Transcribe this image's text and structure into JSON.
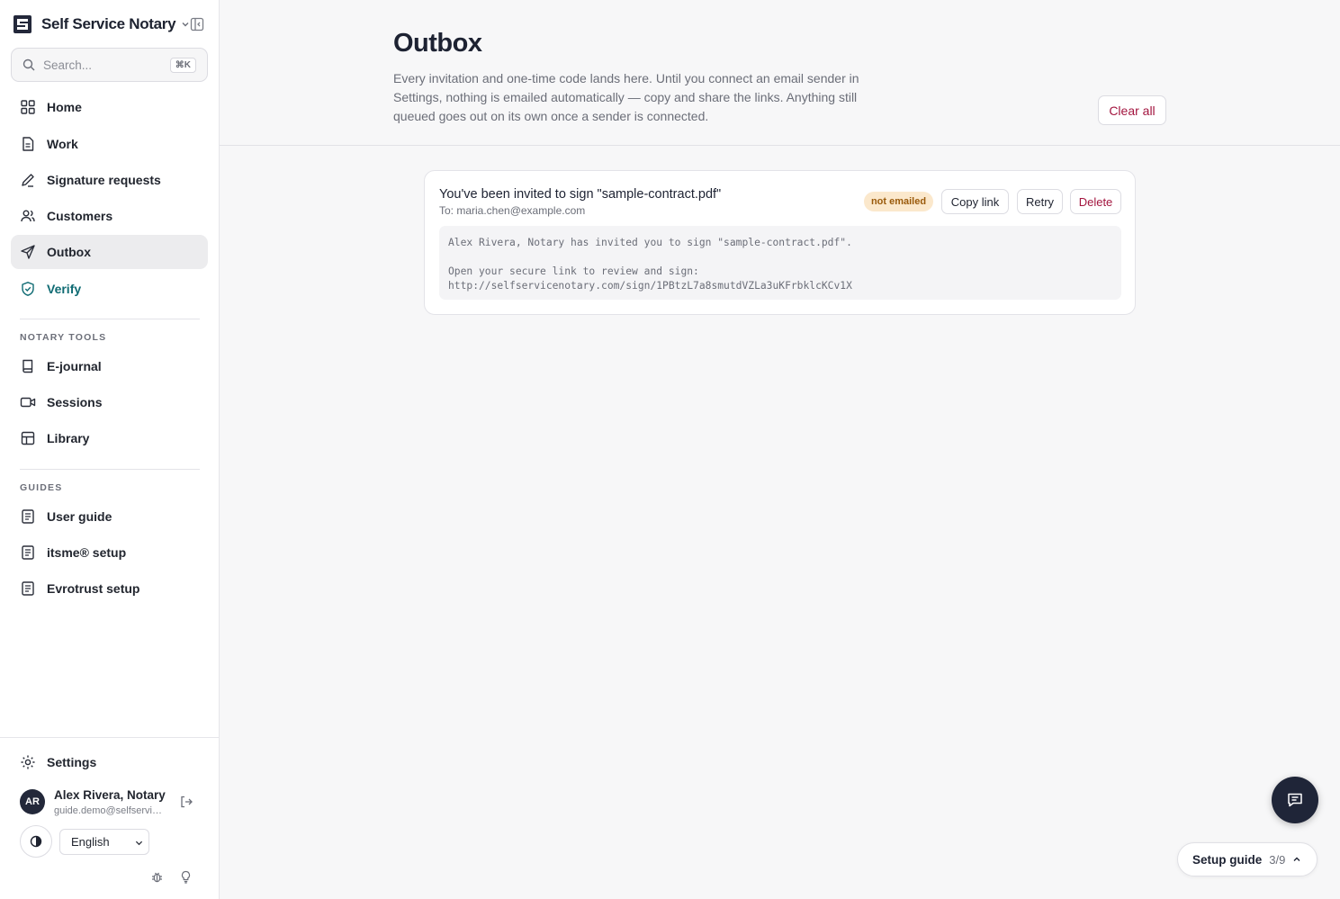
{
  "app": {
    "name": "Self Service Notary"
  },
  "search": {
    "placeholder": "Search...",
    "shortcut": "⌘K"
  },
  "nav": {
    "main": [
      {
        "label": "Home",
        "icon": "grid-icon"
      },
      {
        "label": "Work",
        "icon": "document-icon"
      },
      {
        "label": "Signature requests",
        "icon": "pen-icon"
      },
      {
        "label": "Customers",
        "icon": "users-icon"
      },
      {
        "label": "Outbox",
        "icon": "send-icon",
        "active": true
      },
      {
        "label": "Verify",
        "icon": "shield-check-icon"
      }
    ],
    "notary_tools_label": "NOTARY TOOLS",
    "notary_tools": [
      {
        "label": "E-journal",
        "icon": "book-icon"
      },
      {
        "label": "Sessions",
        "icon": "video-icon"
      },
      {
        "label": "Library",
        "icon": "library-icon"
      }
    ],
    "guides_label": "GUIDES",
    "guides": [
      {
        "label": "User guide",
        "icon": "guide-icon"
      },
      {
        "label": "itsme® setup",
        "icon": "guide-icon"
      },
      {
        "label": "Evrotrust setup",
        "icon": "guide-icon"
      }
    ],
    "settings_label": "Settings"
  },
  "user": {
    "initials": "AR",
    "name": "Alex Rivera, Notary",
    "email": "guide.demo@selfservicenotary.com"
  },
  "language": {
    "selected": "English"
  },
  "page": {
    "title": "Outbox",
    "description": "Every invitation and one-time code lands here. Until you connect an email sender in Settings, nothing is emailed automatically — copy and share the links. Anything still queued goes out on its own once a sender is connected.",
    "clear_all_label": "Clear all"
  },
  "outbox": {
    "items": [
      {
        "subject": "You've been invited to sign \"sample-contract.pdf\"",
        "to": "To: maria.chen@example.com",
        "status": "not emailed",
        "copy_label": "Copy link",
        "retry_label": "Retry",
        "delete_label": "Delete",
        "body_line1": "Alex Rivera, Notary has invited you to sign \"sample-contract.pdf\".",
        "body_line2": "Open your secure link to review and sign:",
        "body_line3": "http://selfservicenotary.com/sign/1PBtzL7a8smutdVZLa3uKFrbklcKCv1X"
      }
    ]
  },
  "setup_guide": {
    "label": "Setup guide",
    "progress": "3/9"
  },
  "colors": {
    "accent_danger": "#a3153f",
    "verify_teal": "#0f6b73",
    "badge_bg": "#fbe8cc",
    "badge_text": "#9a5a0b",
    "fab_bg": "#1f2538"
  }
}
